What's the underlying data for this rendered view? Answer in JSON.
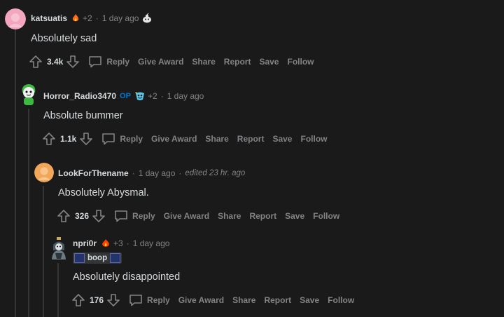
{
  "colors": {
    "background": "#1a1a1b",
    "text": "#d7dadc",
    "muted": "#818384",
    "op": "#0079d3",
    "thread_line": "#343536"
  },
  "actions": {
    "reply": "Reply",
    "give_award": "Give Award",
    "share": "Share",
    "report": "Report",
    "save": "Save",
    "follow": "Follow"
  },
  "comments": [
    {
      "author": "katsuatis",
      "award_icon": "fire-award-icon",
      "award_count": "+2",
      "time": "1 day ago",
      "extra_icon": "snoo-icon",
      "body": "Absolutely sad",
      "votes": "3.4k"
    },
    {
      "author": "Horror_Radio3470",
      "op_label": "OP",
      "award_icon": "starry-award-icon",
      "award_count": "+2",
      "time": "1 day ago",
      "body": "Absolute bummer",
      "votes": "1.1k"
    },
    {
      "author": "LookForThename",
      "time": "1 day ago",
      "edited": "edited 23 hr. ago",
      "body": "Absolutely Abysmal.",
      "votes": "326"
    },
    {
      "author": "npri0r",
      "award_icon": "fire-award-icon",
      "award_count": "+3",
      "time": "1 day ago",
      "flair": "boop",
      "body": "Absolutely disappointed",
      "votes": "176"
    }
  ]
}
